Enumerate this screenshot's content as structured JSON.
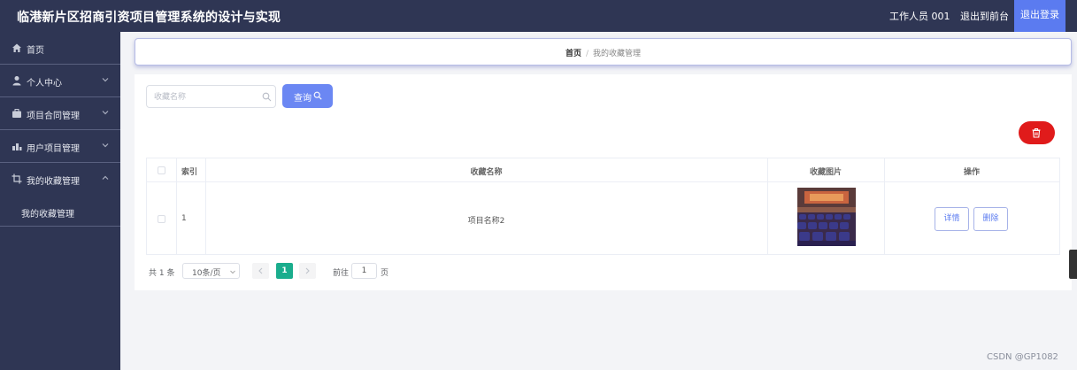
{
  "header": {
    "title": "临港新片区招商引资项目管理系统的设计与实现",
    "user": "工作人员 001",
    "front_link": "退出到前台",
    "logout": "退出登录"
  },
  "sidebar": {
    "items": [
      {
        "label": "首页",
        "icon": "home-icon"
      },
      {
        "label": "个人中心",
        "icon": "user-icon"
      },
      {
        "label": "项目合同管理",
        "icon": "briefcase-icon"
      },
      {
        "label": "用户项目管理",
        "icon": "chart-icon"
      },
      {
        "label": "我的收藏管理",
        "icon": "crop-icon"
      }
    ],
    "sub_item": "我的收藏管理"
  },
  "breadcrumb": {
    "home": "首页",
    "separator": "/",
    "current": "我的收藏管理"
  },
  "search": {
    "placeholder": "收藏名称",
    "value": "",
    "button": "查询"
  },
  "table": {
    "columns": [
      "索引",
      "收藏名称",
      "收藏图片",
      "操作"
    ],
    "rows": [
      {
        "index": "1",
        "name": "项目名称2",
        "image": "conference-hall-photo",
        "detail": "详情",
        "delete": "删除"
      }
    ]
  },
  "pagination": {
    "total": "共 1 条",
    "page_size": "10条/页",
    "current_page": "1",
    "goto_label": "前往",
    "goto_value": "1",
    "page_suffix": "页"
  },
  "colors": {
    "topbar": "#2f3654",
    "accent": "#5b7bf0",
    "danger": "#e01b1b",
    "pager_active": "#1aad8d"
  },
  "watermark": "CSDN @GP1082"
}
